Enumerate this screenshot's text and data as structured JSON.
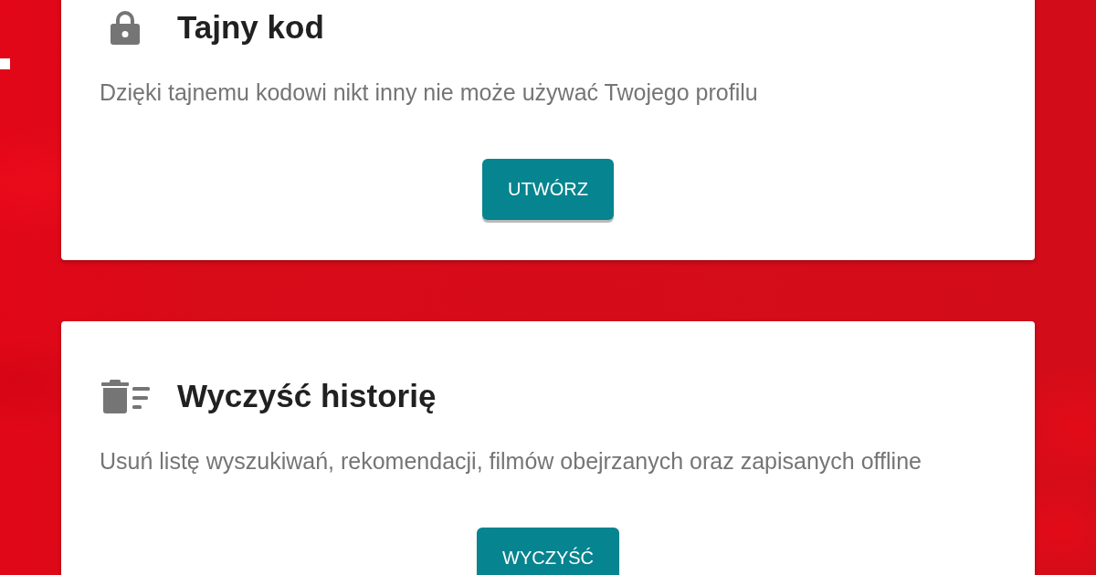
{
  "cards": [
    {
      "kind": "passcode",
      "title": "Tajny kod",
      "description": "Dzięki tajnemu kodowi nikt inny nie może używać Twojego profilu",
      "button": {
        "label": "UTWÓRZ"
      }
    },
    {
      "kind": "history",
      "title": "Wyczyść historię",
      "description": "Usuń listę wyszukiwań, rekomendacji, filmów obejrzanych oraz zapisanych offline",
      "button": {
        "label": "WYCZYŚĆ"
      }
    }
  ]
}
